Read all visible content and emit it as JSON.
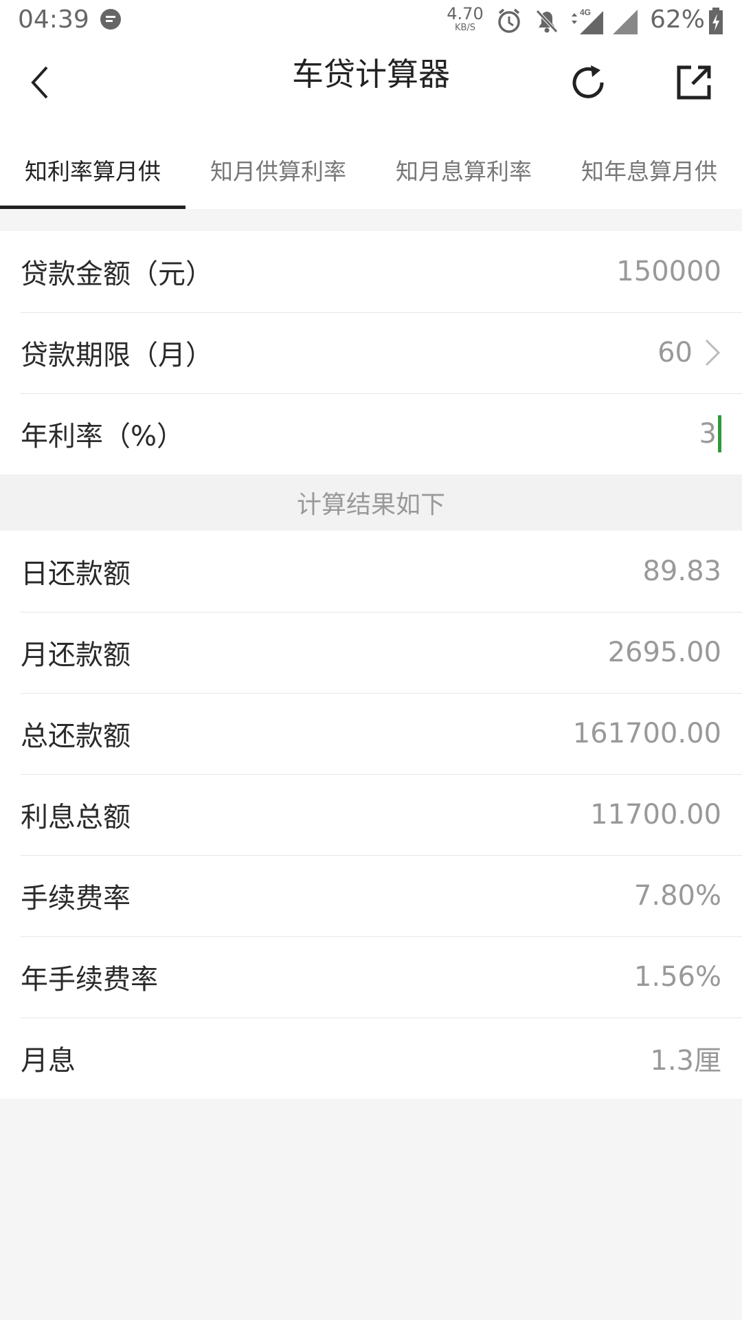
{
  "status_bar": {
    "time": "04:39",
    "net_speed_value": "4.70",
    "net_speed_unit": "KB/S",
    "network": "4G",
    "battery": "62%",
    "icons": [
      "message-icon",
      "alarm-icon",
      "bell-off-icon",
      "data-arrows-icon",
      "signal-icon",
      "battery-charging-icon"
    ]
  },
  "header": {
    "title": "车贷计算器",
    "back_icon": "back-arrow-icon",
    "refresh_icon": "refresh-icon",
    "share_icon": "share-icon"
  },
  "tabs": [
    {
      "label": "知利率算月供",
      "active": true
    },
    {
      "label": "知月供算利率",
      "active": false
    },
    {
      "label": "知月息算利率",
      "active": false
    },
    {
      "label": "知年息算月供",
      "active": false
    }
  ],
  "inputs": {
    "loan_amount": {
      "label": "贷款金额（元）",
      "value": "150000"
    },
    "loan_term": {
      "label": "贷款期限（月）",
      "value": "60"
    },
    "annual_rate": {
      "label": "年利率（%）",
      "value": "3"
    }
  },
  "result_header": "计算结果如下",
  "results": [
    {
      "label": "日还款额",
      "value": "89.83"
    },
    {
      "label": "月还款额",
      "value": "2695.00"
    },
    {
      "label": "总还款额",
      "value": "161700.00"
    },
    {
      "label": "利息总额",
      "value": "11700.00"
    },
    {
      "label": "手续费率",
      "value": "7.80%"
    },
    {
      "label": "年手续费率",
      "value": "1.56%"
    },
    {
      "label": "月息",
      "value": "1.3厘"
    }
  ],
  "colors": {
    "cursor": "#2e9a3a",
    "active_tab_indicator": "#222222",
    "value_text": "#999999",
    "background": "#f5f5f5"
  }
}
